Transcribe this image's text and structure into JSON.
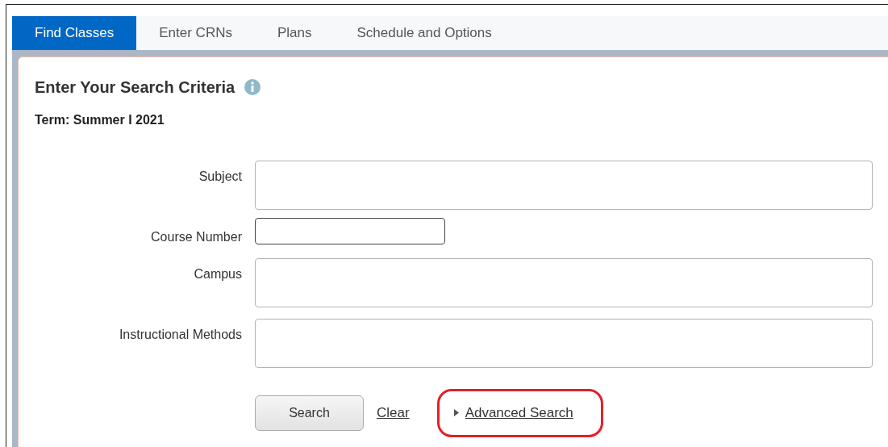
{
  "tabs": [
    {
      "label": "Find Classes",
      "selected": true
    },
    {
      "label": "Enter CRNs",
      "selected": false
    },
    {
      "label": "Plans",
      "selected": false
    },
    {
      "label": "Schedule and Options",
      "selected": false
    }
  ],
  "panel": {
    "title": "Enter Your Search Criteria",
    "term": "Term: Summer I 2021"
  },
  "fields": [
    {
      "label": "Subject",
      "kind": "multi",
      "focused": false
    },
    {
      "label": "Course Number",
      "kind": "text",
      "focused": true
    },
    {
      "label": "Campus",
      "kind": "multi",
      "focused": false
    },
    {
      "label": "Instructional Methods",
      "kind": "multi",
      "focused": false
    }
  ],
  "actions": {
    "search": "Search",
    "clear": "Clear",
    "advanced": {
      "label": "Advanced Search",
      "expanded": false,
      "highlighted": true
    }
  }
}
